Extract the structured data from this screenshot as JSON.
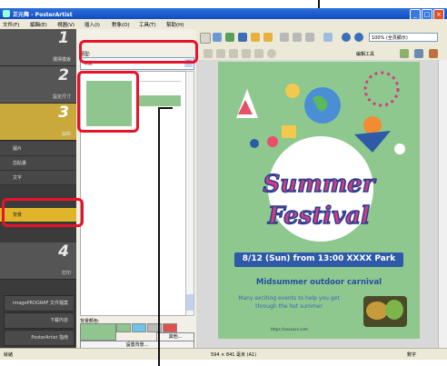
{
  "window": {
    "title": "正元舞 - PosterArtist"
  },
  "menubar": {
    "items": [
      "文件(F)",
      "編輯(E)",
      "視圖(V)",
      "插入(I)",
      "對象(O)",
      "工具(T)",
      "幫助(H)"
    ]
  },
  "sidebar": {
    "steps": [
      {
        "num": "1",
        "label": "選擇模板"
      },
      {
        "num": "2",
        "label": "設定尺寸"
      },
      {
        "num": "3",
        "label": "編輯"
      },
      {
        "num": "4",
        "label": "打印"
      }
    ],
    "subitems": [
      "圖片",
      "剪貼畫",
      "文字",
      "背景"
    ],
    "buttons": [
      "imagePROGRAF 文件檔案",
      "下載內容",
      "PosterArtist 指南"
    ]
  },
  "mid_panel": {
    "category_label": "類型:",
    "category_value": "漸變",
    "bg_color_label": "背景顏色:",
    "swatch_colors": [
      "#8fc58f",
      "#6fc2e8",
      "#b9b9b9",
      "#e05050"
    ],
    "other_button": "其他...",
    "set_button": "設置背景..."
  },
  "toolbar": {
    "zoom_value": "100% (全頁顯示)",
    "edit_tools_label": "編輯工具"
  },
  "poster": {
    "title_line1": "Summer",
    "title_line2": "Festival",
    "ribbon": "8/12 (Sun) from 13:00  XXXX Park",
    "subtitle": "Midsummer outdoor carnival",
    "description": "Many exciting events to help you get through the hot summer",
    "url": "https://xxxxxxx.com",
    "bg_color": "#8ec88f"
  },
  "statusbar": {
    "left": "就緒",
    "center": "594 × 841 毫米 (A1)",
    "right": "數字"
  }
}
